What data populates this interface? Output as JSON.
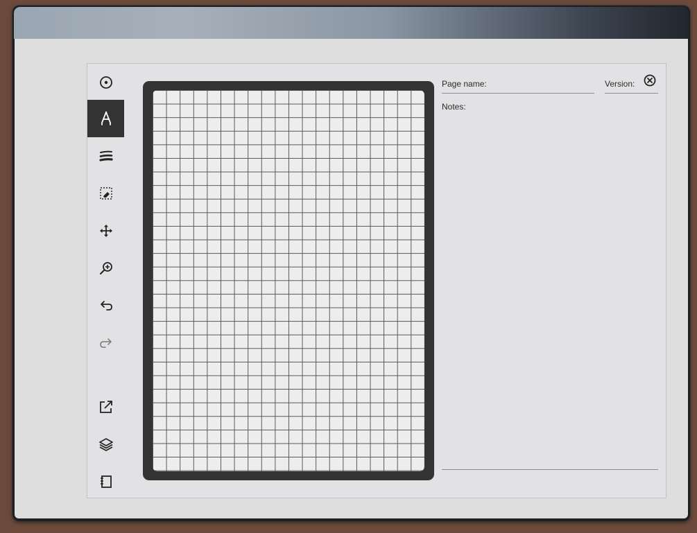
{
  "app": {
    "toolbar": {
      "items": [
        {
          "name": "menu",
          "icon": "circle-dot-icon"
        },
        {
          "name": "pen",
          "icon": "pen-tip-icon",
          "active": true
        },
        {
          "name": "stroke-style",
          "icon": "stroke-width-icon"
        },
        {
          "name": "selection-eraser",
          "icon": "select-erase-icon"
        },
        {
          "name": "move",
          "icon": "move-arrows-icon"
        },
        {
          "name": "zoom",
          "icon": "zoom-in-icon"
        },
        {
          "name": "undo",
          "icon": "undo-icon"
        },
        {
          "name": "redo",
          "icon": "redo-icon"
        },
        {
          "name": "export",
          "icon": "share-out-icon"
        },
        {
          "name": "layers",
          "icon": "layers-icon"
        },
        {
          "name": "notebook",
          "icon": "notebook-icon"
        }
      ]
    },
    "canvas": {
      "template": "grid"
    },
    "info_panel": {
      "page_name_label": "Page name:",
      "version_label": "Version:",
      "notes_label": "Notes:",
      "close_icon": "close-circle-icon"
    },
    "colors": {
      "frame": "#333333",
      "active_tool_bg": "#333333",
      "screen_bg": "#dedede"
    }
  }
}
